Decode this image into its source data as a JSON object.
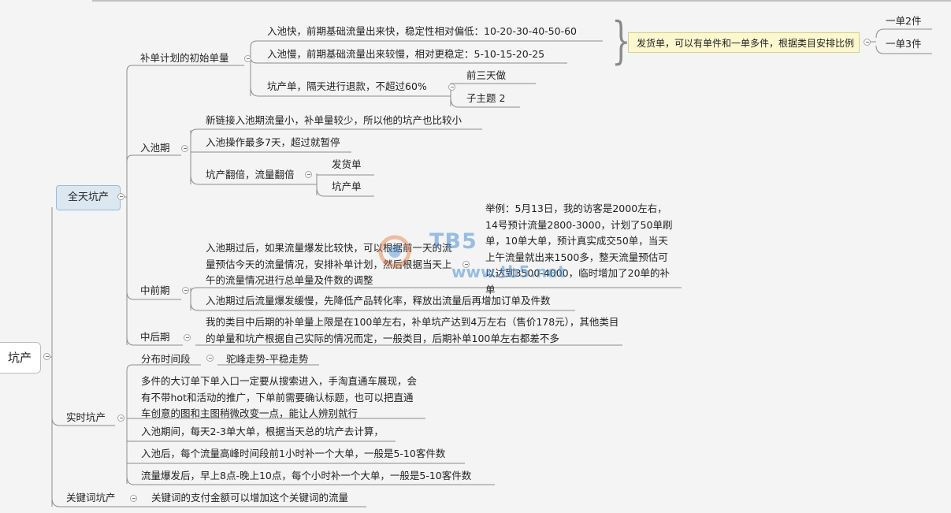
{
  "root": "坑产",
  "main": "全天坑产",
  "branches": {
    "initial": {
      "label": "补单计划的初始单量",
      "items": [
        "入池快，前期基础流量出来快，稳定性相对偏低：10-20-30-40-50-60",
        "入池慢，前期基础流量出来较慢，相对更稳定：5-10-15-20-25",
        "坑产单，隔天进行退款，不超过60%"
      ],
      "sub": [
        "前三天做",
        "子主题 2"
      ],
      "note": "发货单，可以有单件和一单多件，根据类目安排比例",
      "note_children": [
        "一单2件",
        "一单3件"
      ]
    },
    "pool": {
      "label": "入池期",
      "items": [
        "新链接入池期流量小，补单量较少，所以他的坑产也比较小",
        "入池操作最多7天，超过就暂停",
        "坑产翻倍，流量翻倍"
      ],
      "sub": [
        "发货单",
        "坑产单"
      ]
    },
    "midfront": {
      "label": "中前期",
      "item1": "入池期过后，如果流量爆发比较快，可以根据前一天的流量预估今天的流量情况，安排补单计划，然后根据当天上午的流量情况进行总单量及件数的调整",
      "example": "举例：5月13日，我的访客是2000左右，14号预计流量2800-3000，计划了50单刷单，10单大单，预计真实成交50单，当天上午流量就出来1500多，整天流量预估可以达到3500-4000，临时增加了20单的补单",
      "item2": "入池期过后流量爆发缓慢，先降低产品转化率，释放出流量后再增加订单及件数"
    },
    "midlate": {
      "label": "中后期",
      "text": "我的类目中后期的补单量上限是在100单左右，补单坑产达到4万左右（售价178元），其他类目的单量和坑产根据自己实际的情况而定，一般类目，后期补单100单左右都差不多"
    },
    "realtime": {
      "label": "实时坑产",
      "dist_label": "分布时间段",
      "dist_value": "驼峰走势-平稳走势",
      "items": [
        "多件的大订单下单入口一定要从搜索进入，手淘直通车展现，会有不带hot和活动的推广，下单前需要确认标题，也可以把直通车创意的图和主图稍微改变一点，能让人辨别就行",
        "入池期间，每天2-3单大单，根据当天总的坑产去计算，",
        "入池后，每个流量高峰时间段前1小时补一个大单，一般是5-10客件数",
        "流量爆发后，早上8点-晚上10点，每个小时补一个大单，一般是5-10客件数"
      ]
    },
    "keyword": {
      "label": "关键词坑产",
      "text": "关键词的支付金额可以增加这个关键词的流量"
    }
  },
  "watermark": {
    "brand": "TB5",
    "site": "www.tb5.net"
  },
  "colors": {
    "line": "#8c8c8c",
    "main_fill": "#dbe8f2",
    "note_fill": "#fbf8cf",
    "watermark": "#4a8fd6"
  }
}
